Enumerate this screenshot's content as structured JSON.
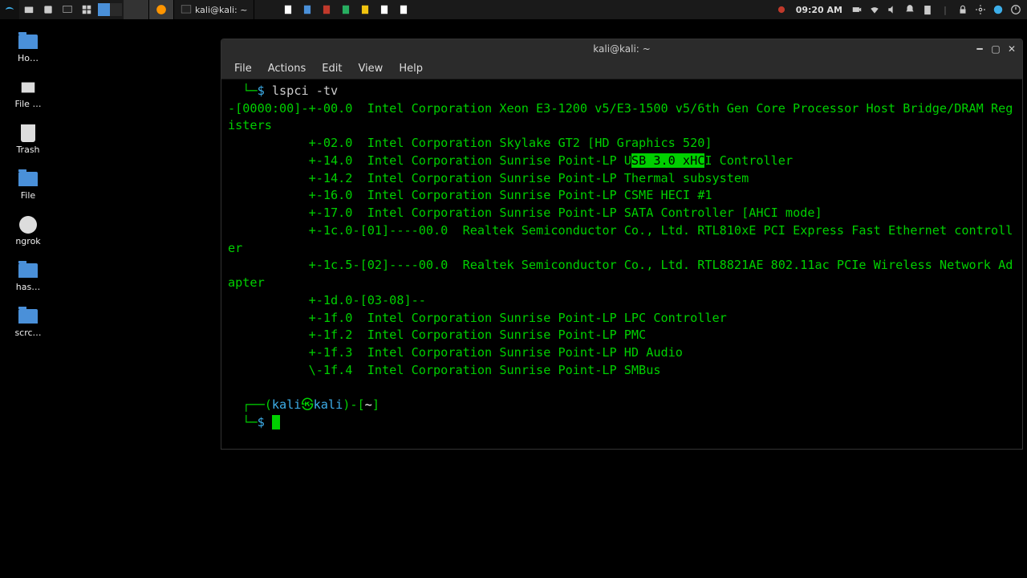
{
  "panel": {
    "task_terminal": "kali@kali: ~",
    "clock": "09:20 AM"
  },
  "desktop": {
    "icons": [
      "Ho…",
      "File …",
      "Trash",
      "File",
      "ngrok",
      "has…",
      "scrc…"
    ]
  },
  "terminal": {
    "title": "kali@kali: ~",
    "menus": [
      "File",
      "Actions",
      "Edit",
      "View",
      "Help"
    ],
    "prompt_symbol": "$",
    "command": "lspci -tv",
    "prompt_user": "kali",
    "prompt_host": "kali",
    "prompt_path": "~",
    "output_lines": [
      "-[0000:00]-+-00.0  Intel Corporation Xeon E3-1200 v5/E3-1500 v5/6th Gen Core Processor Host Bridge/DRAM Registers",
      "           +-02.0  Intel Corporation Skylake GT2 [HD Graphics 520]",
      "           +-14.0  Intel Corporation Sunrise Point-LP U",
      "SB 3.0 xHC",
      "I Controller",
      "           +-14.2  Intel Corporation Sunrise Point-LP Thermal subsystem",
      "           +-16.0  Intel Corporation Sunrise Point-LP CSME HECI #1",
      "           +-17.0  Intel Corporation Sunrise Point-LP SATA Controller [AHCI mode]",
      "           +-1c.0-[01]----00.0  Realtek Semiconductor Co., Ltd. RTL810xE PCI Express Fast Ethernet controller",
      "           +-1c.5-[02]----00.0  Realtek Semiconductor Co., Ltd. RTL8821AE 802.11ac PCIe Wireless Network Adapter",
      "           +-1d.0-[03-08]--",
      "           +-1f.0  Intel Corporation Sunrise Point-LP LPC Controller",
      "           +-1f.2  Intel Corporation Sunrise Point-LP PMC",
      "           +-1f.3  Intel Corporation Sunrise Point-LP HD Audio",
      "           \\-1f.4  Intel Corporation Sunrise Point-LP SMBus"
    ]
  }
}
